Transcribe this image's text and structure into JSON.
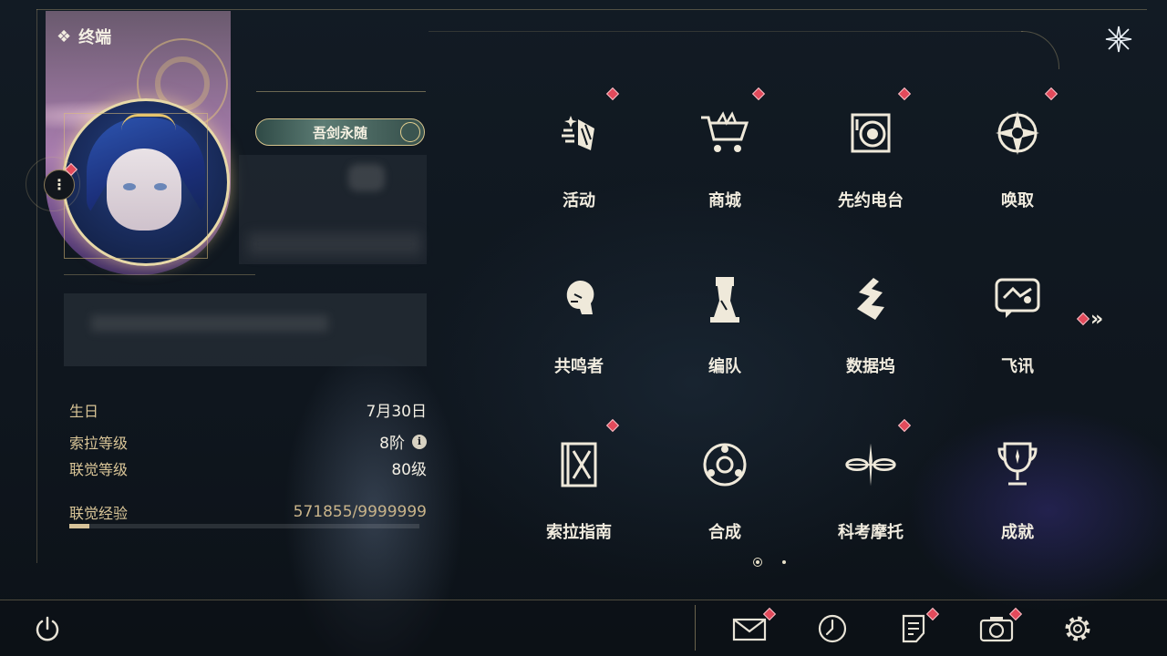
{
  "header": {
    "title": "终端",
    "title_glyph": "❖"
  },
  "profile": {
    "title_badge": "吾剑永随",
    "menu_glyph": "⋮"
  },
  "stats": {
    "birthday_label": "生日",
    "birthday_value": "7月30日",
    "sola_level_label": "索拉等级",
    "sola_level_value": "8阶",
    "union_level_label": "联觉等级",
    "union_level_value": "80级",
    "union_exp_label": "联觉经验",
    "union_exp_value": "571855/9999999",
    "union_exp_fraction": 0.057
  },
  "grid": [
    {
      "label": "活动",
      "icon": "events-icon",
      "badge": true
    },
    {
      "label": "商城",
      "icon": "shop-cart-icon",
      "badge": true
    },
    {
      "label": "先约电台",
      "icon": "pioneer-radio-icon",
      "badge": true
    },
    {
      "label": "唤取",
      "icon": "convene-icon",
      "badge": true
    },
    {
      "label": "共鸣者",
      "icon": "resonator-icon",
      "badge": false
    },
    {
      "label": "编队",
      "icon": "chess-formation-icon",
      "badge": false
    },
    {
      "label": "数据坞",
      "icon": "data-bank-icon",
      "badge": false
    },
    {
      "label": "飞讯",
      "icon": "chat-message-icon",
      "badge": false
    },
    {
      "label": "索拉指南",
      "icon": "guidebook-icon",
      "badge": true
    },
    {
      "label": "合成",
      "icon": "synthesis-icon",
      "badge": false
    },
    {
      "label": "科考摩托",
      "icon": "motorcycle-icon",
      "badge": true
    },
    {
      "label": "成就",
      "icon": "trophy-icon",
      "badge": false
    }
  ],
  "next_page_glyph": "»",
  "bottom_bar": [
    "power-icon",
    "mail-icon",
    "clock-icon",
    "notice-icon",
    "camera-icon",
    "settings-icon"
  ],
  "colors": {
    "accent_gold": "#d9c597",
    "badge_red": "#e24a5b",
    "background": "#0e141b"
  }
}
